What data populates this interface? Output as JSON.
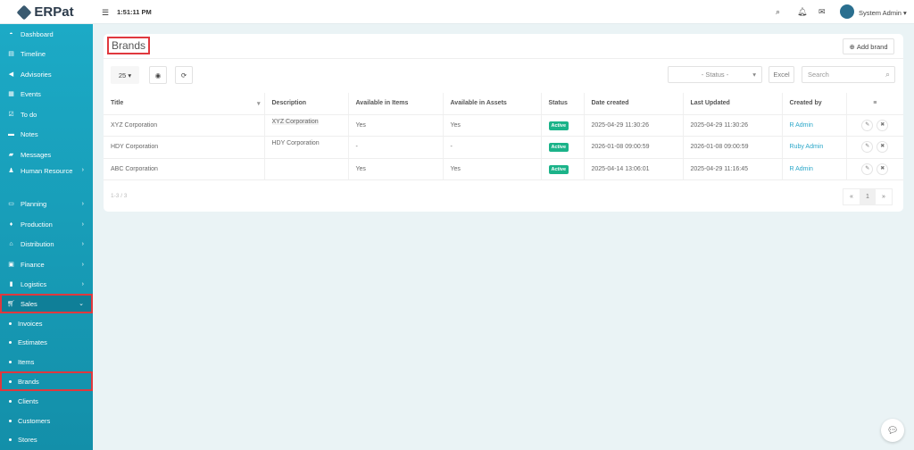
{
  "app": {
    "logo": "ERPat",
    "clock": "1:51:11 PM",
    "user": "System Admin"
  },
  "sidebar": [
    {
      "label": "Dashboard",
      "icon": "dashboard-icon"
    },
    {
      "label": "Timeline",
      "icon": "timeline-icon"
    },
    {
      "label": "Advisories",
      "icon": "megaphone-icon"
    },
    {
      "label": "Events",
      "icon": "calendar-icon"
    },
    {
      "label": "To do",
      "icon": "checkbox-icon"
    },
    {
      "label": "Notes",
      "icon": "note-icon"
    },
    {
      "label": "Messages",
      "icon": "message-icon"
    },
    {
      "label": "Human Resource",
      "icon": "users-icon"
    },
    {
      "label": "Planning",
      "icon": "briefcase-icon"
    },
    {
      "label": "Production",
      "icon": "flask-icon"
    },
    {
      "label": "Distribution",
      "icon": "bank-icon"
    },
    {
      "label": "Finance",
      "icon": "money-icon"
    },
    {
      "label": "Logistics",
      "icon": "truck-icon"
    },
    {
      "label": "Sales",
      "icon": "cart-icon"
    }
  ],
  "sales_sub": [
    "Invoices",
    "Estimates",
    "Items",
    "Brands",
    "Clients",
    "Customers",
    "Stores"
  ],
  "page": {
    "title": "Brands",
    "add_button": "Add brand",
    "page_size": "25",
    "status_filter": "- Status -",
    "excel": "Excel",
    "search_placeholder": "Search",
    "count": "1-3 / 3",
    "current_page": "1"
  },
  "table": {
    "headers": [
      "Title",
      "Description",
      "Available in Items",
      "Available in Assets",
      "Status",
      "Date created",
      "Last Updated",
      "Created by"
    ],
    "rows": [
      {
        "title": "XYZ Corporation",
        "description": "XYZ Corporation",
        "items": "Yes",
        "assets": "Yes",
        "status": "Active",
        "created": "2025-04-29 11:30:26",
        "updated": "2025-04-29 11:30:26",
        "by": "R Admin"
      },
      {
        "title": "HDY Corporation",
        "description": "HDY Corporation",
        "items": "-",
        "assets": "-",
        "status": "Active",
        "created": "2026-01-08 09:00:59",
        "updated": "2026-01-08 09:00:59",
        "by": "Ruby Admin"
      },
      {
        "title": "ABC Corporation",
        "description": "",
        "items": "Yes",
        "assets": "Yes",
        "status": "Active",
        "created": "2025-04-14 13:06:01",
        "updated": "2025-04-29 11:16:45",
        "by": "R Admin"
      }
    ]
  }
}
